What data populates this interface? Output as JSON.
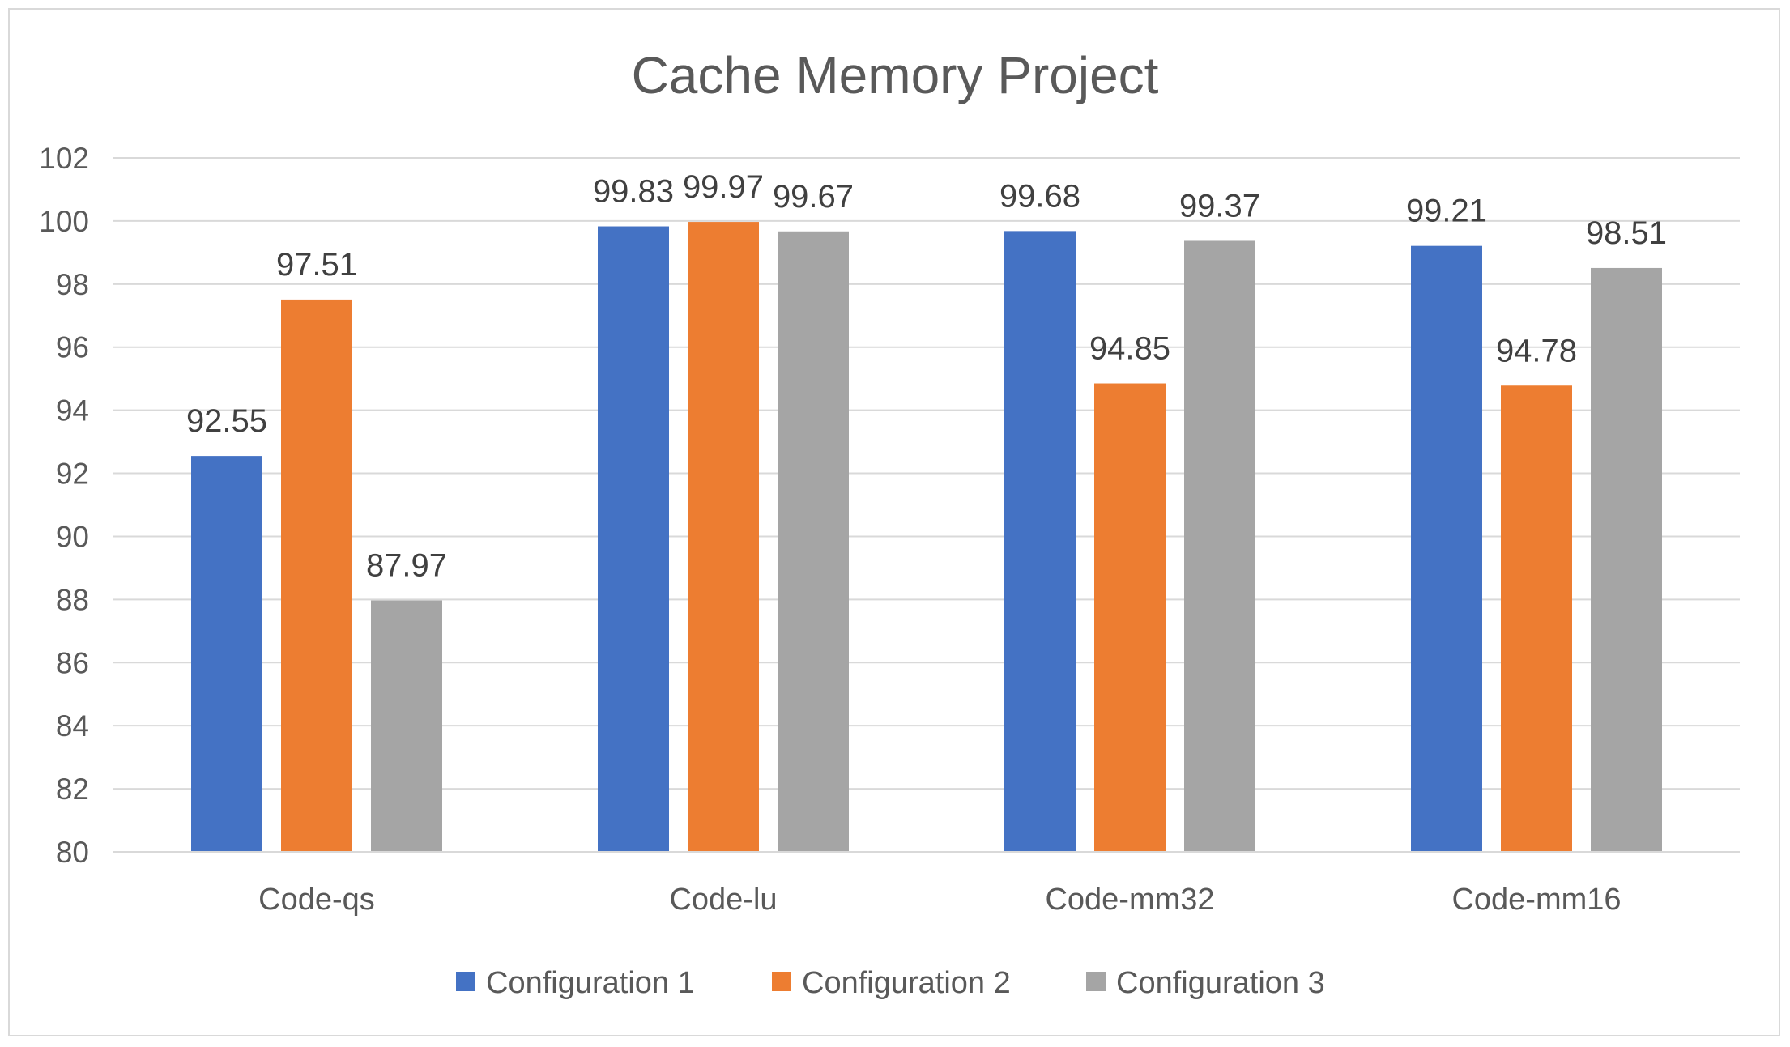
{
  "chart_data": {
    "type": "bar",
    "title": "Cache Memory Project",
    "xlabel": "",
    "ylabel": "",
    "ylim": [
      80,
      102
    ],
    "ytick_step": 2,
    "yticks": [
      "80",
      "82",
      "84",
      "86",
      "88",
      "90",
      "92",
      "94",
      "96",
      "98",
      "100",
      "102"
    ],
    "grid": true,
    "legend_position": "bottom",
    "categories": [
      "Code-qs",
      "Code-lu",
      "Code-mm32",
      "Code-mm16"
    ],
    "series": [
      {
        "name": "Configuration 1",
        "color": "#4472c4",
        "values": [
          92.55,
          99.83,
          99.68,
          99.21
        ],
        "labels": [
          "92.55",
          "99.83",
          "99.68",
          "99.21"
        ]
      },
      {
        "name": "Configuration 2",
        "color": "#ed7d31",
        "values": [
          97.51,
          99.97,
          94.85,
          94.78
        ],
        "labels": [
          "97.51",
          "99.97",
          "94.85",
          "94.78"
        ]
      },
      {
        "name": "Configuration 3",
        "color": "#a5a5a5",
        "values": [
          87.97,
          99.67,
          99.37,
          98.51
        ],
        "labels": [
          "87.97",
          "99.67",
          "99.37",
          "98.51"
        ]
      }
    ]
  }
}
